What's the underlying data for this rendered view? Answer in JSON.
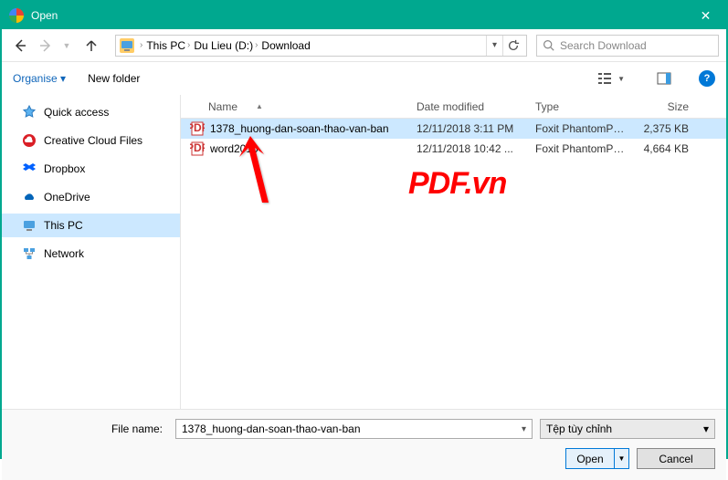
{
  "window": {
    "title": "Open"
  },
  "nav": {
    "breadcrumbs": [
      "This PC",
      "Du Lieu (D:)",
      "Download"
    ],
    "search_placeholder": "Search Download"
  },
  "toolbar": {
    "organise": "Organise",
    "newfolder": "New folder"
  },
  "sidebar": {
    "items": [
      {
        "label": "Quick access"
      },
      {
        "label": "Creative Cloud Files"
      },
      {
        "label": "Dropbox"
      },
      {
        "label": "OneDrive"
      },
      {
        "label": "This PC"
      },
      {
        "label": "Network"
      }
    ]
  },
  "columns": {
    "name": "Name",
    "date": "Date modified",
    "type": "Type",
    "size": "Size"
  },
  "files": [
    {
      "name": "1378_huong-dan-soan-thao-van-ban",
      "date": "12/11/2018 3:11 PM",
      "type": "Foxit PhantomPD...",
      "size": "2,375 KB",
      "selected": true
    },
    {
      "name": "word2010",
      "date": "12/11/2018 10:42 ...",
      "type": "Foxit PhantomPD...",
      "size": "4,664 KB",
      "selected": false
    }
  ],
  "footer": {
    "filename_label": "File name:",
    "filename_value": "1378_huong-dan-soan-thao-van-ban",
    "filter_label": "Tệp tùy chỉnh",
    "open": "Open",
    "cancel": "Cancel"
  },
  "watermark": "PDF.vn"
}
